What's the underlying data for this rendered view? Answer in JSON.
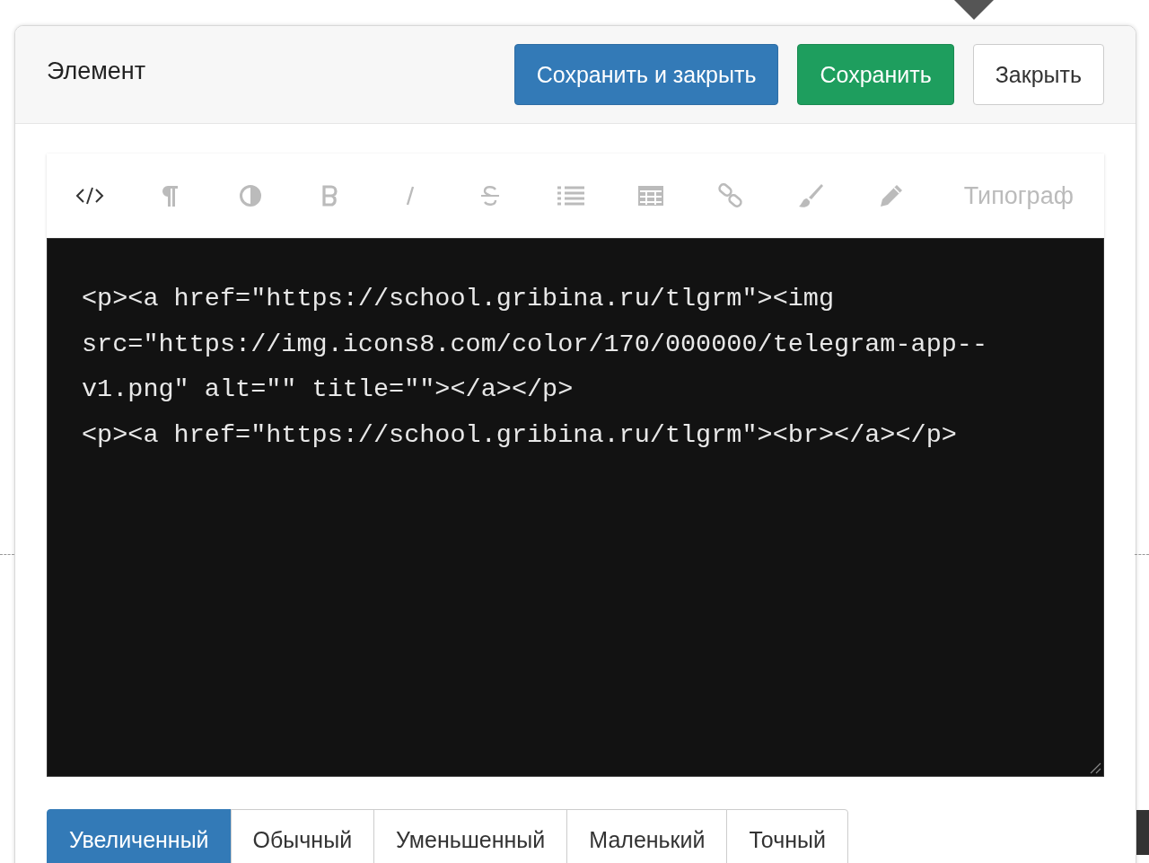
{
  "modal": {
    "title": "Элемент",
    "buttons": [
      {
        "label": "Сохранить и закрыть",
        "kind": "primary"
      },
      {
        "label": "Сохранить",
        "kind": "success"
      },
      {
        "label": "Закрыть",
        "kind": "default"
      }
    ]
  },
  "toolbar": {
    "items": [
      {
        "kind": "code",
        "disabled": false
      },
      {
        "kind": "paragraph",
        "disabled": true
      },
      {
        "kind": "contrast",
        "disabled": true
      },
      {
        "kind": "bold",
        "disabled": true
      },
      {
        "kind": "italic",
        "disabled": true
      },
      {
        "kind": "strike",
        "disabled": true
      },
      {
        "kind": "list",
        "disabled": true
      },
      {
        "kind": "table",
        "disabled": true
      },
      {
        "kind": "link",
        "disabled": true
      },
      {
        "kind": "brush",
        "disabled": true
      },
      {
        "kind": "pencil",
        "disabled": true
      },
      {
        "kind": "text",
        "label": "Типограф",
        "disabled": true
      }
    ]
  },
  "editor": {
    "lines": [
      "<p><a href=\"https://school.gribina.ru/tlgrm\"><img",
      "src=\"https://img.icons8.com/color/170/000000/telegram-app--",
      "v1.png\" alt=\"\" title=\"\"></a></p>",
      "<p><a href=\"https://school.gribina.ru/tlgrm\"><br></a></p>"
    ]
  },
  "size_tabs": [
    {
      "label": "Увеличенный",
      "selected": true
    },
    {
      "label": "Обычный",
      "selected": false
    },
    {
      "label": "Уменьшенный",
      "selected": false
    },
    {
      "label": "Маленький",
      "selected": false
    },
    {
      "label": "Точный",
      "selected": false
    }
  ]
}
